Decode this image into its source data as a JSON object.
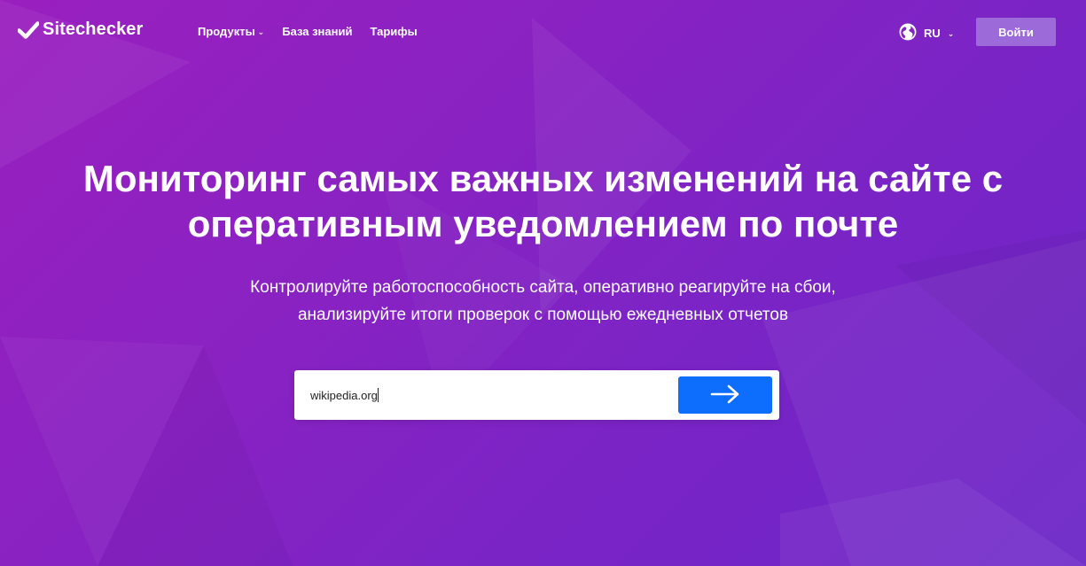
{
  "header": {
    "logo_text": "Sitechecker",
    "nav": {
      "products": "Продукты",
      "knowledge_base": "База знаний",
      "pricing": "Тарифы"
    },
    "language": "RU",
    "login_label": "Войти"
  },
  "hero": {
    "title_line1": "Мониторинг самых важных изменений на сайте с",
    "title_line2": "оперативным уведомлением по почте",
    "subtitle_line1": "Контролируйте работоспособность сайта, оперативно реагируйте на сбои,",
    "subtitle_line2": "анализируйте итоги проверок с помощью ежедневных отчетов"
  },
  "search": {
    "value": "wikipedia.org"
  },
  "icons": {
    "logo": "checkmark-icon",
    "products_dropdown": "chevron-down-icon",
    "language": "globe-icon",
    "language_dropdown": "chevron-down-icon",
    "submit": "arrow-right-icon"
  },
  "colors": {
    "background_start": "#9a1fbf",
    "background_end": "#6c26c8",
    "login_button": "#9c6bd9",
    "submit_button": "#0d6efd"
  }
}
